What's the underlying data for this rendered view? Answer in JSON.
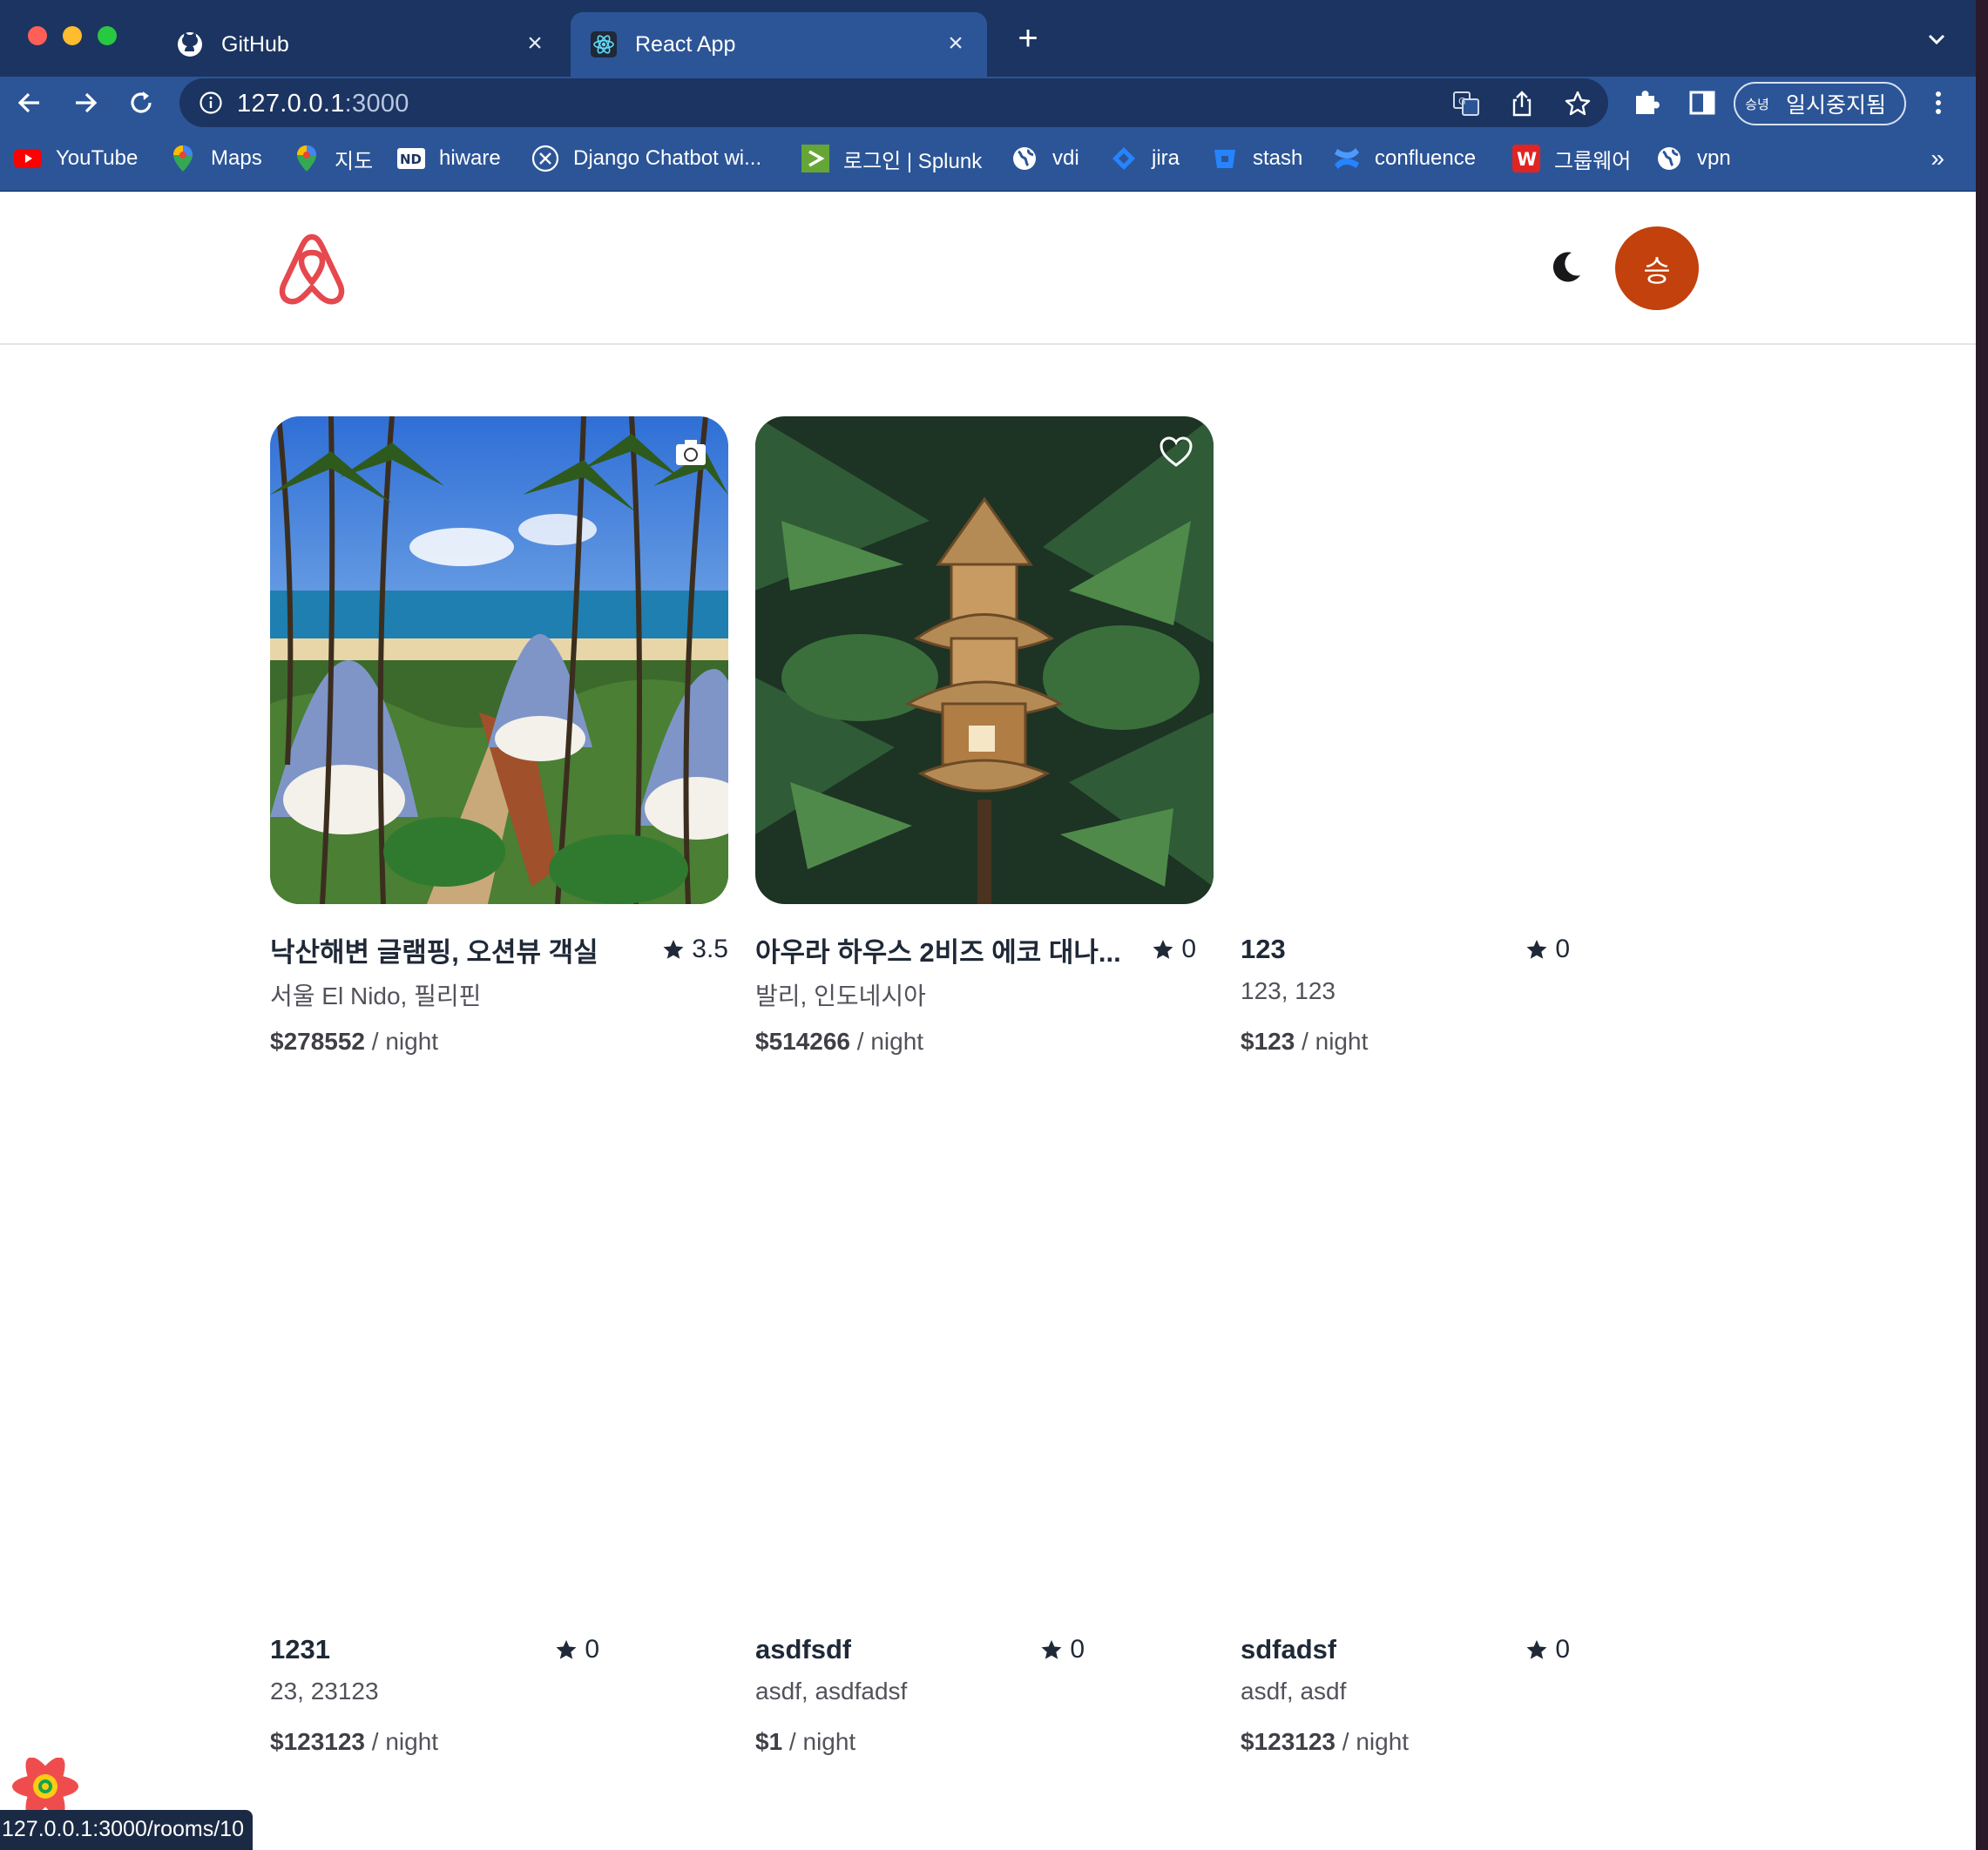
{
  "browser": {
    "tabs": [
      {
        "title": "GitHub",
        "icon": "github-icon"
      },
      {
        "title": "React App",
        "icon": "react-icon",
        "active": true
      }
    ],
    "url_host": "127.0.0.1",
    "url_port": ":3000",
    "profile_label": "일시중지됨",
    "profile_avatar": "승녕",
    "bookmarks": [
      {
        "label": "YouTube",
        "icon": "youtube-icon"
      },
      {
        "label": "Maps",
        "icon": "maps-pin-icon"
      },
      {
        "label": "지도",
        "icon": "maps-pin-icon"
      },
      {
        "label": "hiware",
        "icon": "nd-icon"
      },
      {
        "label": "Django Chatbot wi...",
        "icon": "x-circle-icon"
      },
      {
        "label": "로그인 | Splunk",
        "icon": "splunk-icon"
      },
      {
        "label": "vdi",
        "icon": "globe-icon"
      },
      {
        "label": "jira",
        "icon": "jira-icon"
      },
      {
        "label": "stash",
        "icon": "stash-icon"
      },
      {
        "label": "confluence",
        "icon": "confluence-icon"
      },
      {
        "label": "그룹웨어",
        "icon": "w-icon"
      },
      {
        "label": "vpn",
        "icon": "globe-icon"
      }
    ],
    "bookmarks_more": "»",
    "status_url": "127.0.0.1:3000/rooms/10"
  },
  "app": {
    "user_initial": "승",
    "colors": {
      "brand": "#e5484d",
      "avatar": "#c2410c"
    },
    "rooms": [
      {
        "name": "낙산해변 글램핑, 오션뷰 객실",
        "rating": "3.5",
        "location": "서울 El Nido, 필리핀",
        "price": "$278552",
        "per": " / night",
        "photo": "beach-glamping",
        "icon": "camera-icon"
      },
      {
        "name": "아우라 하우스 2비즈 에코 대나...",
        "rating": "0",
        "location": "발리, 인도네시아",
        "price": "$514266",
        "per": " / night",
        "photo": "bamboo-house",
        "icon": "heart-icon"
      },
      {
        "name": "123",
        "rating": "0",
        "location": "123, 123",
        "price": "$123",
        "per": " / night",
        "photo": "none"
      },
      {
        "name": "1231",
        "rating": "0",
        "location": "23, 23123",
        "price": "$123123",
        "per": " / night",
        "photo": "none"
      },
      {
        "name": "asdfsdf",
        "rating": "0",
        "location": "asdf, asdfadsf",
        "price": "$1",
        "per": " / night",
        "photo": "none"
      },
      {
        "name": "sdfadsf",
        "rating": "0",
        "location": "asdf, asdf",
        "price": "$123123",
        "per": " / night",
        "photo": "none"
      }
    ]
  }
}
